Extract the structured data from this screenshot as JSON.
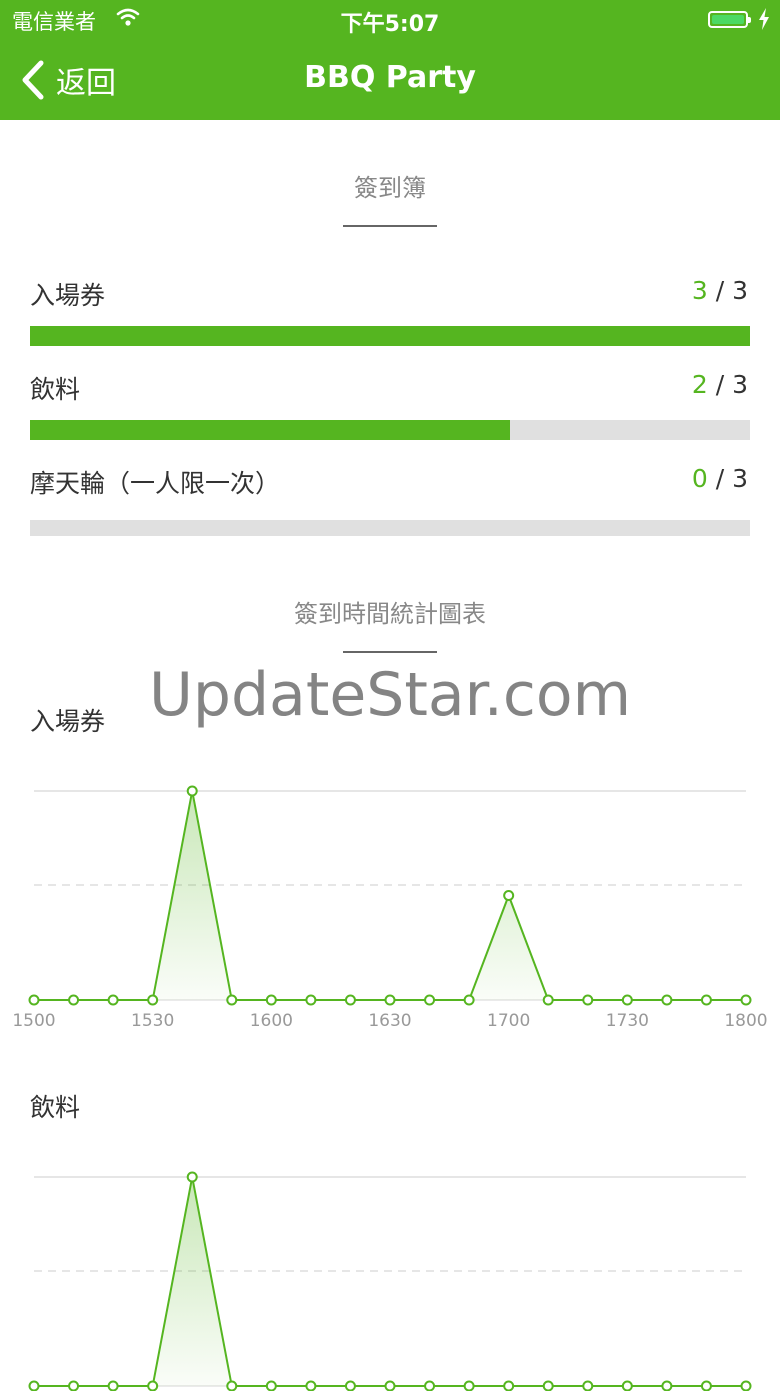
{
  "status_bar": {
    "carrier": "電信業者",
    "time": "下午5:07"
  },
  "nav": {
    "back_label": "返回",
    "title": "BBQ Party"
  },
  "checkin": {
    "title": "簽到簿",
    "items": [
      {
        "label": "入場券",
        "current": "3",
        "sep": " / ",
        "total": "3",
        "fraction": 1.0
      },
      {
        "label": "飲料",
        "current": "2",
        "sep": " / ",
        "total": "3",
        "fraction": 0.6667
      },
      {
        "label": "摩天輪（一人限一次）",
        "current": "0",
        "sep": " / ",
        "total": "3",
        "fraction": 0
      }
    ]
  },
  "stats": {
    "title": "簽到時間統計圖表"
  },
  "watermark": "UpdateStar.com",
  "colors": {
    "brand": "#55b520",
    "track": "#e0e0e0"
  },
  "chart_data": [
    {
      "type": "area",
      "title": "入場券",
      "x_ticks": [
        "1500",
        "1530",
        "1600",
        "1630",
        "1700",
        "1730",
        "1800"
      ],
      "values": [
        0,
        0,
        0,
        0,
        2,
        0,
        0,
        0,
        0,
        0,
        0,
        0,
        1,
        0,
        0,
        0,
        0,
        0,
        0
      ],
      "ylim": [
        0,
        2
      ],
      "grid": true
    },
    {
      "type": "area",
      "title": "飲料",
      "x_ticks": [],
      "values": [
        0,
        0,
        0,
        0,
        2,
        0,
        0,
        0,
        0,
        0,
        0,
        0,
        0,
        0,
        0,
        0,
        0,
        0,
        0
      ],
      "ylim": [
        0,
        2
      ],
      "grid": true
    }
  ]
}
